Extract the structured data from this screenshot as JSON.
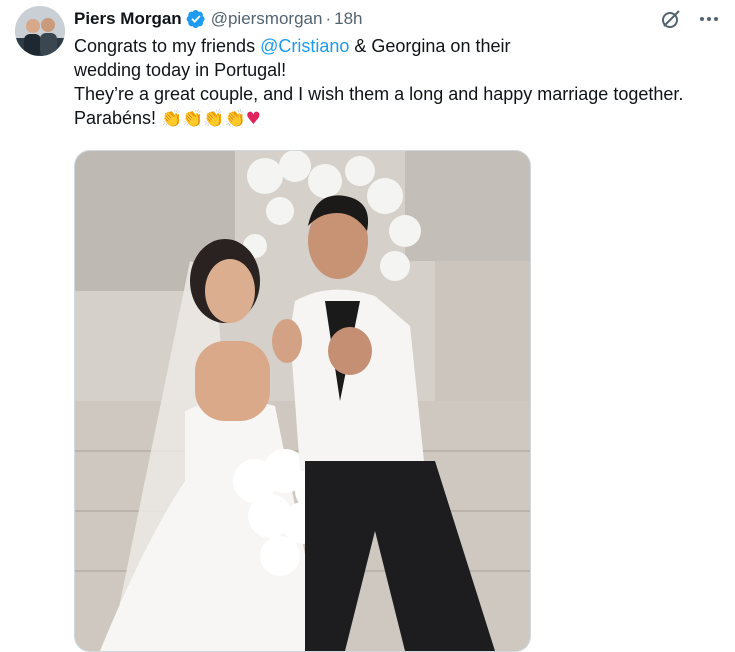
{
  "tweet": {
    "author_name": "Piers Morgan",
    "handle": "@piersmorgan",
    "separator": "·",
    "time": "18h",
    "verified_icon": "verified-badge-icon",
    "accent_color": "#1d9bf0",
    "text": {
      "line1_before": "Congrats to my friends ",
      "mention": "@Cristiano",
      "line1_after": " & Georgina on their",
      "line2": "wedding today in Portugal!",
      "line3": "They’re a great couple, and I wish them a long and happy marriage together.",
      "line4_word": "Parabéns! ",
      "emojis": "👏👏👏👏",
      "heart": "♥"
    },
    "media_description_icon": "wedding-photo",
    "actions": {
      "grok_icon": "grok-icon",
      "more_icon": "more-horizontal-icon"
    }
  }
}
